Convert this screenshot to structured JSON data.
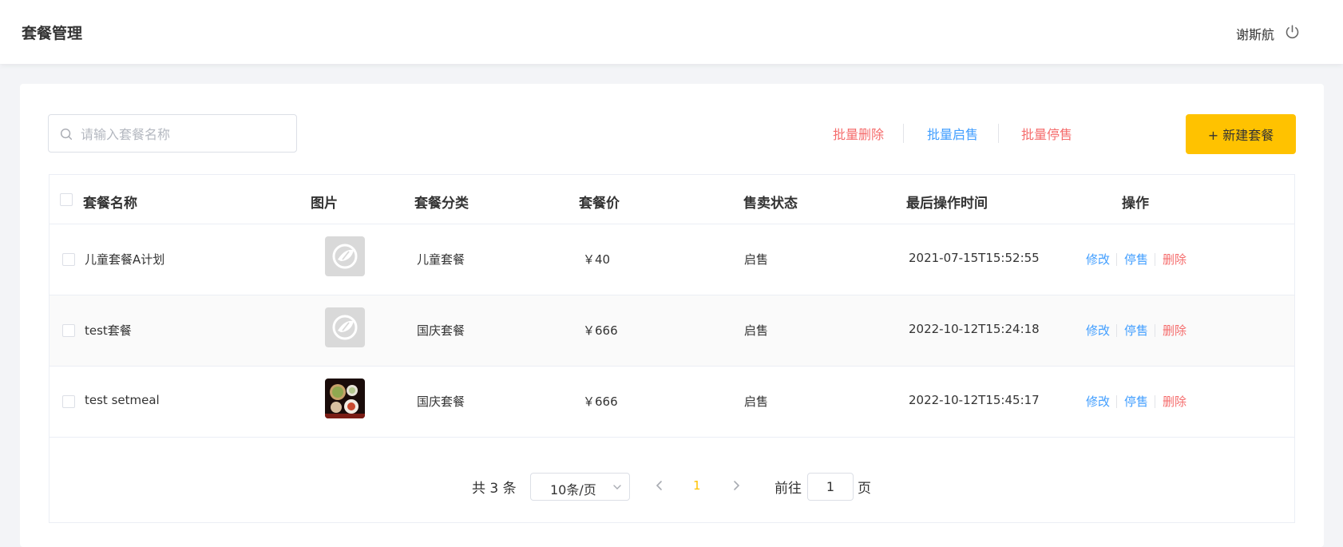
{
  "header": {
    "title": "套餐管理",
    "user_name": "谢斯航"
  },
  "toolbar": {
    "search_placeholder": "请输入套餐名称",
    "batch_delete": "批量删除",
    "batch_enable": "批量启售",
    "batch_disable": "批量停售",
    "add_button": "+ 新建套餐"
  },
  "table": {
    "columns": [
      "套餐名称",
      "图片",
      "套餐分类",
      "套餐价",
      "售卖状态",
      "最后操作时间",
      "操作"
    ],
    "rows": [
      {
        "name": "儿童套餐A计划",
        "image": "placeholder-logo",
        "category": "儿童套餐",
        "price": "￥40",
        "status": "启售",
        "updated": "2021-07-15T15:52:55",
        "edit": "修改",
        "toggle": "停售",
        "delete": "删除"
      },
      {
        "name": "test套餐",
        "image": "placeholder-logo",
        "category": "国庆套餐",
        "price": "￥666",
        "status": "启售",
        "updated": "2022-10-12T15:24:18",
        "edit": "修改",
        "toggle": "停售",
        "delete": "删除"
      },
      {
        "name": "test setmeal",
        "image": "food-photo",
        "category": "国庆套餐",
        "price": "￥666",
        "status": "启售",
        "updated": "2022-10-12T15:45:17",
        "edit": "修改",
        "toggle": "停售",
        "delete": "删除"
      }
    ]
  },
  "pagination": {
    "total": "共 3 条",
    "page_size": "10条/页",
    "current_page": "1",
    "goto_label": "前往",
    "goto_value": "1",
    "goto_unit": "页"
  },
  "colors": {
    "accent": "#ffc200",
    "link_blue": "#419eff",
    "link_red": "#f56c6c"
  }
}
